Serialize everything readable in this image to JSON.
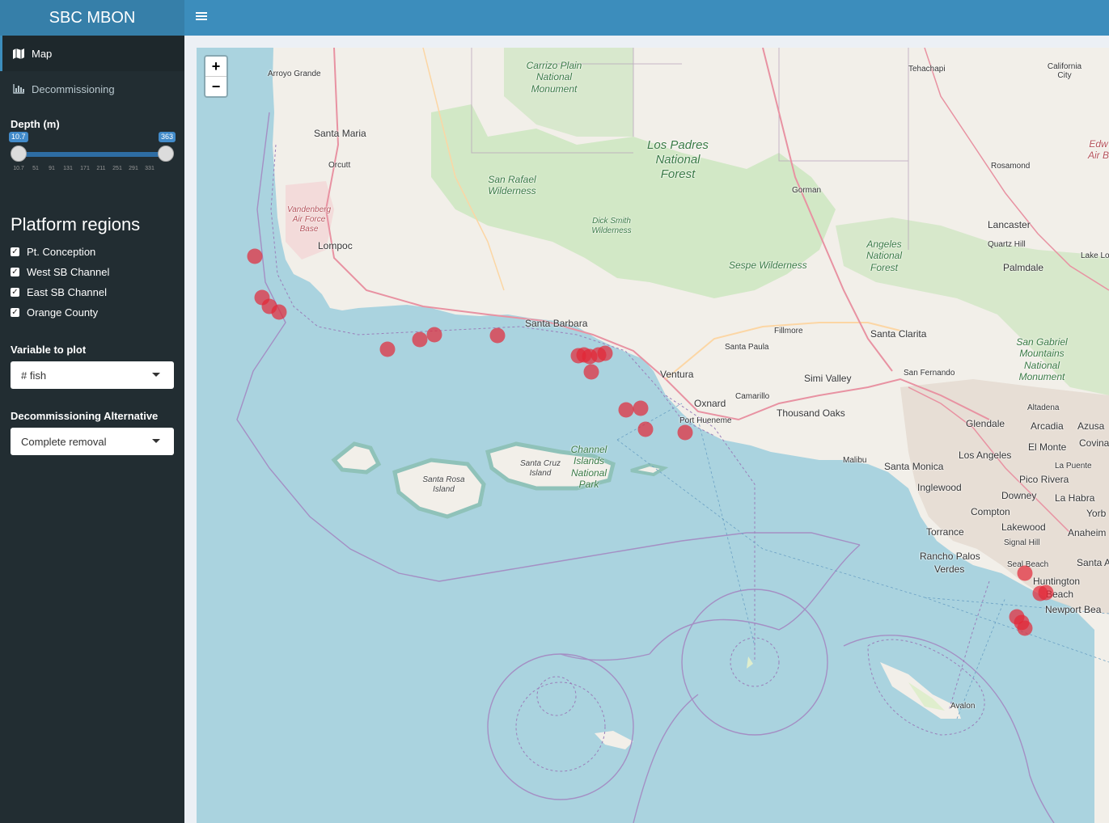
{
  "app": {
    "title": "SBC MBON"
  },
  "sidebar": {
    "menu": [
      {
        "label": "Map",
        "icon": "map-icon",
        "active": true
      },
      {
        "label": "Decommissioning",
        "icon": "bar-chart-icon",
        "active": false
      }
    ],
    "depth": {
      "label": "Depth (m)",
      "min": "10.7",
      "max": "363",
      "ticks": [
        "10.7",
        "51",
        "91",
        "131",
        "171",
        "211",
        "251",
        "291",
        "331"
      ]
    },
    "regions_title": "Platform regions",
    "regions": [
      {
        "label": "Pt. Conception",
        "checked": true
      },
      {
        "label": "West SB Channel",
        "checked": true
      },
      {
        "label": "East SB Channel",
        "checked": true
      },
      {
        "label": "Orange County",
        "checked": true
      }
    ],
    "variable": {
      "label": "Variable to plot",
      "value": "# fish"
    },
    "alternative": {
      "label": "Decommissioning Alternative",
      "value": "Complete removal"
    }
  },
  "map": {
    "zoom_in": "+",
    "zoom_out": "−",
    "marker_color": "#e32636",
    "places": {
      "arroyo_grande": "Arroyo Grande",
      "santa_maria": "Santa Maria",
      "orcutt": "Orcutt",
      "lompoc": "Lompoc",
      "santa_barbara": "Santa Barbara",
      "ventura": "Ventura",
      "oxnard": "Oxnard",
      "port_hueneme": "Port Hueneme",
      "camarillo": "Camarillo",
      "santa_paula": "Santa Paula",
      "fillmore": "Fillmore",
      "simi_valley": "Simi Valley",
      "thousand_oaks": "Thousand Oaks",
      "santa_clarita": "Santa Clarita",
      "san_fernando": "San Fernando",
      "glendale": "Glendale",
      "los_angeles": "Los Angeles",
      "santa_monica": "Santa Monica",
      "malibu": "Malibu",
      "inglewood": "Inglewood",
      "compton": "Compton",
      "downey": "Downey",
      "torrance": "Torrance",
      "lakewood": "Lakewood",
      "signal_hill": "Signal Hill",
      "seal_beach": "Seal Beach",
      "huntington": "Huntington",
      "beach": "Beach",
      "newport": "Newport Bea",
      "rancho_palos": "Rancho Palos",
      "verdes": "Verdes",
      "pico_rivera": "Pico Rivera",
      "la_habra": "La Habra",
      "anaheim": "Anaheim",
      "yorb": "Yorb",
      "santa_a": "Santa A",
      "arcadia": "Arcadia",
      "azusa": "Azusa",
      "el_monte": "El Monte",
      "covina": "Covina",
      "la_puente": "La Puente",
      "altadena": "Altadena",
      "gorman": "Gorman",
      "lancaster": "Lancaster",
      "quartz_hill": "Quartz Hill",
      "palmdale": "Palmdale",
      "lake_lo": "Lake Lo",
      "rosamond": "Rosamond",
      "tehachapi": "Tehachapi",
      "california_city": "California City",
      "avalon": "Avalon",
      "edw": "Edw Air B"
    },
    "parks": {
      "carrizo": "Carrizo Plain National Monument",
      "los_padres": "Los Padres National Forest",
      "san_rafael": "San Rafael Wilderness",
      "dick_smith": "Dick Smith Wilderness",
      "sespe": "Sespe Wilderness",
      "angeles": "Angeles National Forest",
      "san_gabriel": "San Gabriel Mountains National Monument",
      "channel_islands": "Channel Islands National Park"
    },
    "military": {
      "vandenberg": "Vandenberg Air Force Base"
    },
    "islands": {
      "santa_cruz": "Santa Cruz Island",
      "santa_rosa": "Santa Rosa Island"
    }
  }
}
